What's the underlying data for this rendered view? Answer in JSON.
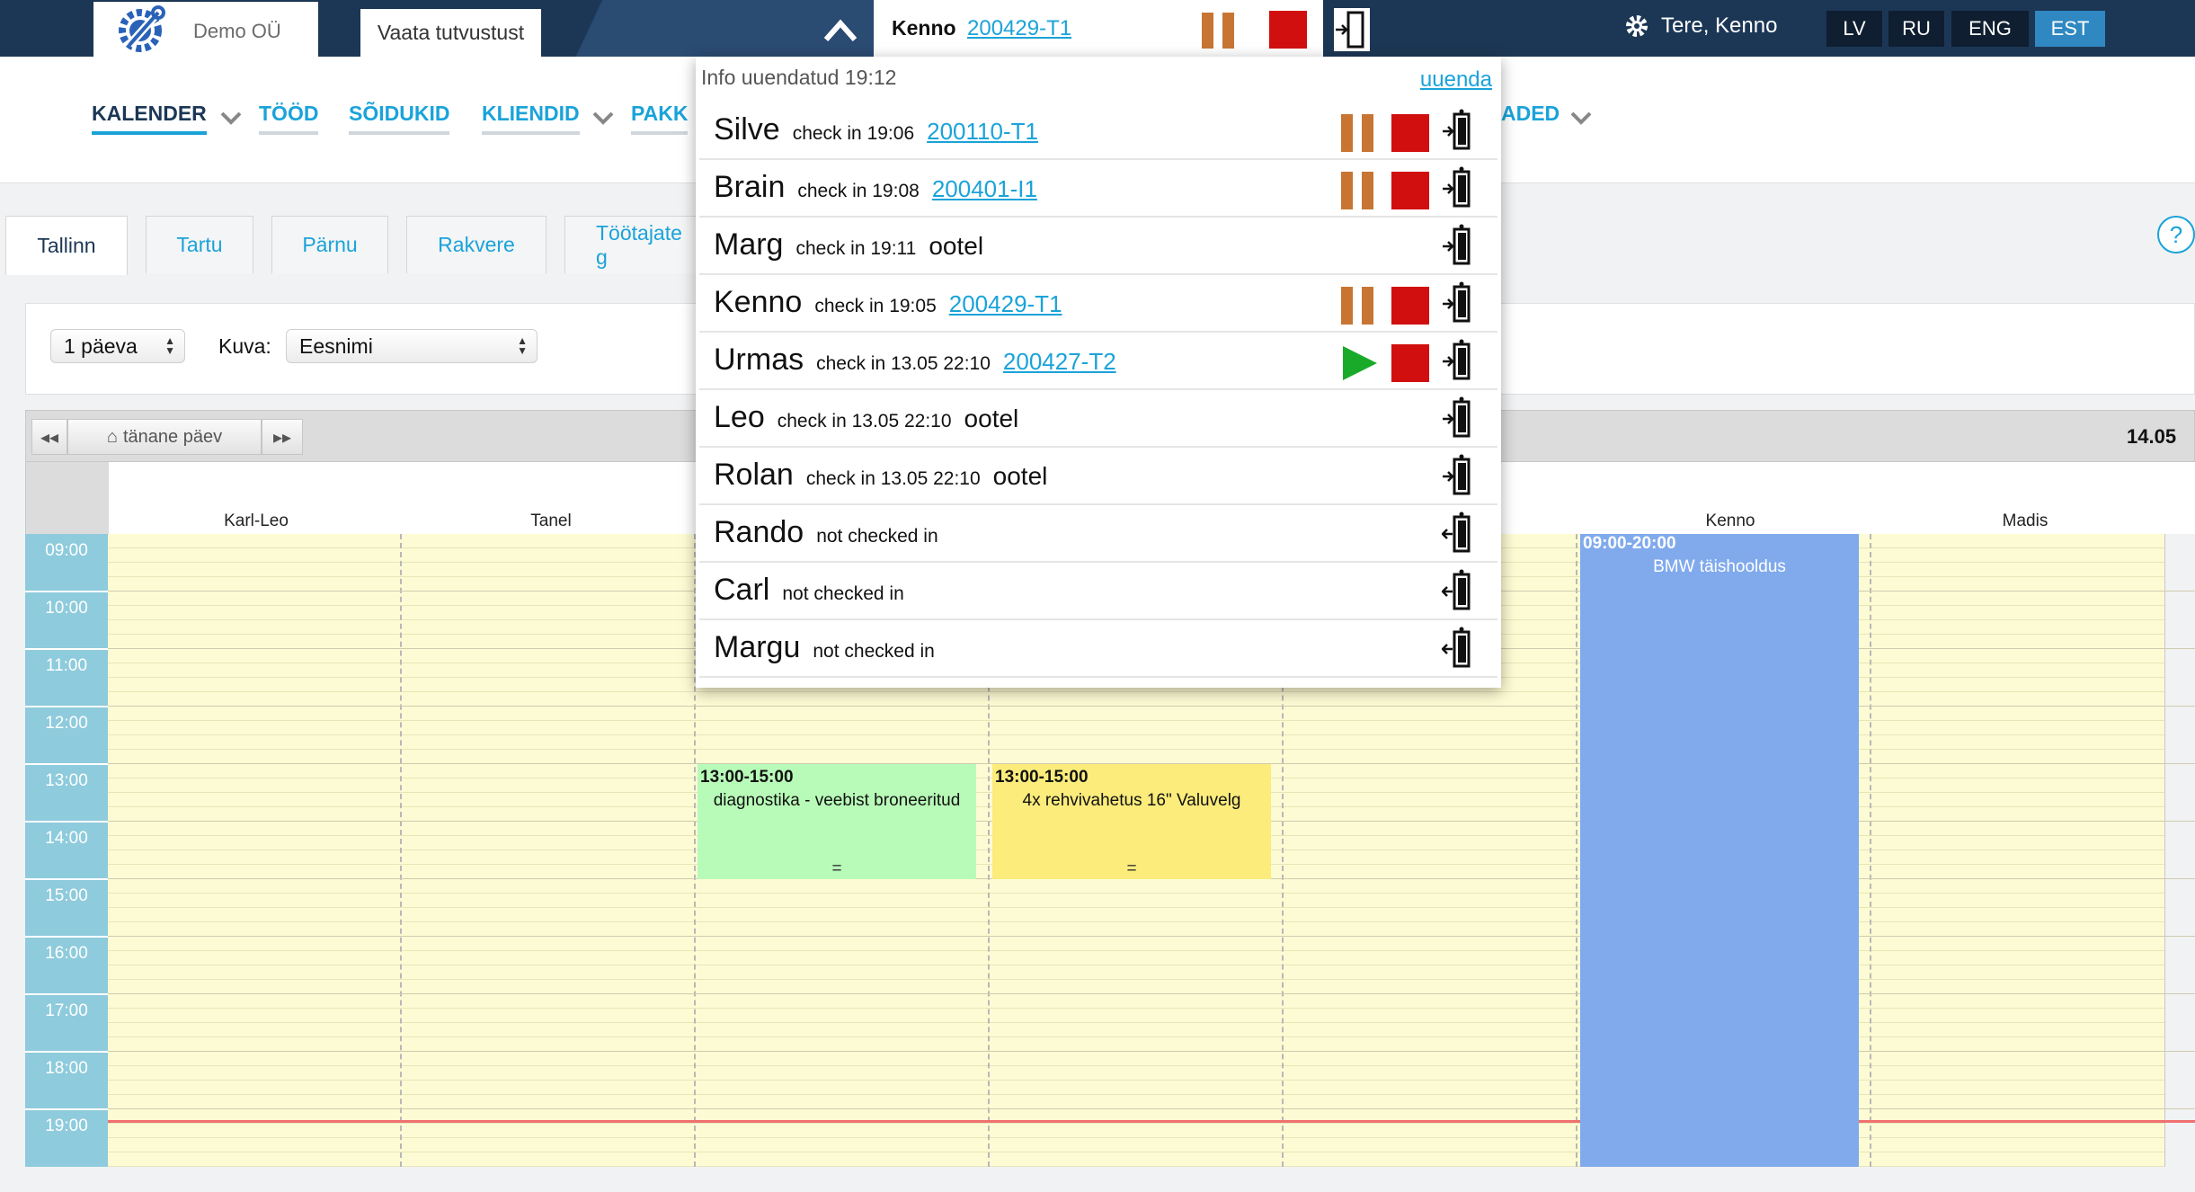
{
  "topbar": {
    "company": "Demo OÜ",
    "guide_tab": "Vaata tutvustust",
    "active_person": "Kenno",
    "active_job": "200429-T1",
    "greeting": "Tere, Kenno",
    "languages": [
      "LV",
      "RU",
      "ENG",
      "EST"
    ],
    "active_language": "EST"
  },
  "nav": {
    "items": [
      "KALENDER",
      "TÖÖD",
      "SÕIDUKID",
      "KLIENDID",
      "PAKK",
      "ADED"
    ]
  },
  "locations": [
    "Tallinn",
    "Tartu",
    "Pärnu",
    "Rakvere",
    "Töötajate g"
  ],
  "filters": {
    "period": "1 päeva",
    "view_label": "Kuva:",
    "view_value": "Eesnimi"
  },
  "calendar": {
    "today_button": "tänane päev",
    "date": "14.05",
    "employees": [
      "Karl-Leo",
      "Tanel",
      "",
      "",
      "",
      "Kenno",
      "Madis"
    ],
    "hours": [
      "09:00",
      "10:00",
      "11:00",
      "12:00",
      "13:00",
      "14:00",
      "15:00",
      "16:00",
      "17:00",
      "18:00",
      "19:00"
    ],
    "events": [
      {
        "time": "13:00-15:00",
        "title": "diagnostika - veebist broneeritud",
        "mark": "=",
        "color": "#b8fbb8"
      },
      {
        "time": "13:00-15:00",
        "title": "4x rehvivahetus 16\" Valuvelg",
        "mark": "=",
        "color": "#fbec7b"
      },
      {
        "time": "09:00-20:00",
        "title": "BMW täishooldus",
        "mark": "",
        "color": "#80aaec"
      }
    ]
  },
  "checkin_panel": {
    "info": "Info uuendatud 19:12",
    "refresh": "uuenda",
    "rows": [
      {
        "name": "Silve",
        "status": "check in 19:06",
        "job": "200110-T1",
        "job_link": true,
        "state": "pause"
      },
      {
        "name": "Brain",
        "status": "check in 19:08",
        "job": "200401-I1",
        "job_link": true,
        "state": "pause"
      },
      {
        "name": "Marg",
        "status": "check in 19:11",
        "job": "ootel",
        "job_link": false,
        "state": "idle"
      },
      {
        "name": "Kenno",
        "status": "check in 19:05",
        "job": "200429-T1",
        "job_link": true,
        "state": "pause"
      },
      {
        "name": "Urmas",
        "status": "check in 13.05 22:10",
        "job": "200427-T2",
        "job_link": true,
        "state": "play"
      },
      {
        "name": "Leo",
        "status": "check in 13.05 22:10",
        "job": "ootel",
        "job_link": false,
        "state": "idle"
      },
      {
        "name": "Rolan",
        "status": "check in 13.05 22:10",
        "job": "ootel",
        "job_link": false,
        "state": "idle"
      },
      {
        "name": "Rando",
        "status": "not checked in",
        "job": "",
        "job_link": false,
        "state": "out"
      },
      {
        "name": "Carl",
        "status": "not checked in",
        "job": "",
        "job_link": false,
        "state": "out"
      },
      {
        "name": "Margu",
        "status": "not checked in",
        "job": "",
        "job_link": false,
        "state": "out"
      }
    ]
  },
  "colors": {
    "topbar": "#1c3755",
    "accent": "#1aa3d9",
    "pause": "#c87533",
    "stop": "#d10f0f",
    "play": "#1aaa2a",
    "time_column": "#8ecbdc",
    "now_line": "#f07070"
  }
}
